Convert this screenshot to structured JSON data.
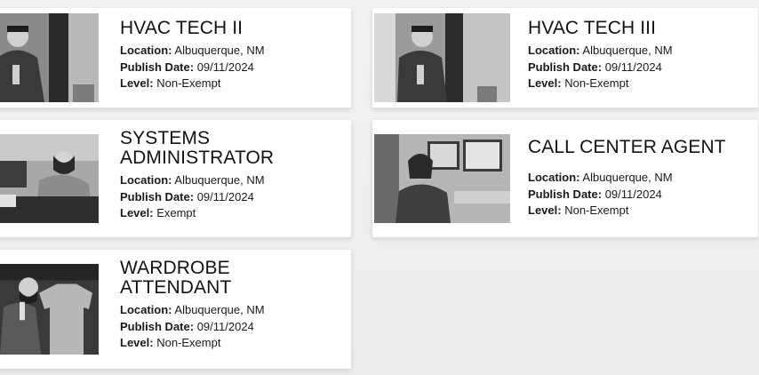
{
  "jobs": [
    {
      "title_lines": [
        "HVAC TECH II"
      ],
      "location_label": "Location:",
      "location": "Albuquerque, NM",
      "publish_label": "Publish Date:",
      "publish_date": "09/11/2024",
      "level_label": "Level:",
      "level": "Non-Exempt"
    },
    {
      "title_lines": [
        "HVAC TECH III"
      ],
      "location_label": "Location:",
      "location": "Albuquerque, NM",
      "publish_label": "Publish Date:",
      "publish_date": "09/11/2024",
      "level_label": "Level:",
      "level": "Non-Exempt"
    },
    {
      "title_lines": [
        "SYSTEMS",
        "ADMINISTRATOR"
      ],
      "location_label": "Location:",
      "location": "Albuquerque, NM",
      "publish_label": "Publish Date:",
      "publish_date": "09/11/2024",
      "level_label": "Level:",
      "level": "Exempt"
    },
    {
      "title_lines": [
        "CALL CENTER AGENT"
      ],
      "location_label": "Location:",
      "location": "Albuquerque, NM",
      "publish_label": "Publish Date:",
      "publish_date": "09/11/2024",
      "level_label": "Level:",
      "level": "Non-Exempt"
    },
    {
      "title_lines": [
        "WARDROBE",
        "ATTENDANT"
      ],
      "location_label": "Location:",
      "location": "Albuquerque, NM",
      "publish_label": "Publish Date:",
      "publish_date": "09/11/2024",
      "level_label": "Level:",
      "level": "Non-Exempt"
    }
  ]
}
